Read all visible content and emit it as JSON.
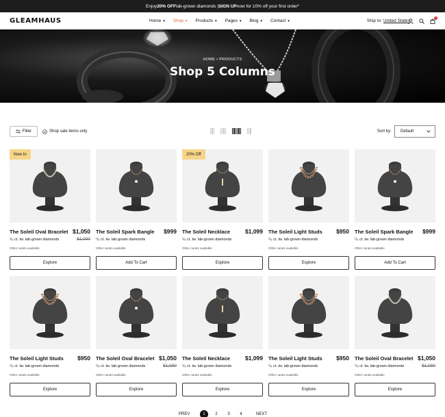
{
  "announcement": {
    "pre": "Enjoy ",
    "bold1": "20% OFF",
    "mid": " lab-grown diamonds | ",
    "bold2": "SIGN UP",
    "post": " now for 10% off your first order*"
  },
  "header": {
    "logo": "GLEAMHAUS",
    "nav": [
      "Home",
      "Shop",
      "Products",
      "Pages",
      "Blog",
      "Contact"
    ],
    "active_nav": "Shop",
    "ship_label": "Ship to:",
    "ship_value": "United States",
    "cart_count": "0",
    "accent": "#e06a3c"
  },
  "hero": {
    "breadcrumb_home": "HOME",
    "breadcrumb_sep": "•",
    "breadcrumb_current": "PRODUCTS",
    "title": "Shop 5 Columns"
  },
  "toolbar": {
    "filter_label": "Filter",
    "sale_label": "Shop sale items only",
    "sort_label": "Sort by:",
    "sort_value": "Default",
    "active_view": "5 columns"
  },
  "products": [
    {
      "name": "The Soleil Oval Bracelet",
      "price": "$1,050",
      "old_price": "$1,090",
      "desc": "¹/₄ ct. tw. lab-grown diamonds",
      "carats": "Other carats available",
      "button": "Explore",
      "tag": "New In",
      "necklace": "pearl"
    },
    {
      "name": "The Soleil Spark Bangle",
      "price": "$999",
      "old_price": "",
      "desc": "¹/₄ ct. tw. lab-grown diamonds",
      "carats": "Other carats available",
      "button": "Add To Cart",
      "tag": "",
      "necklace": "pendant"
    },
    {
      "name": "The Soleil Necklace",
      "price": "$1,099",
      "old_price": "",
      "desc": "¹/₄ ct. tw. lab-grown diamonds",
      "carats": "Other carats available",
      "button": "Explore",
      "tag": "20% Off",
      "necklace": "bar"
    },
    {
      "name": "The Soleil Light Studs",
      "price": "$950",
      "old_price": "",
      "desc": "¹/₄ ct. tw. lab-grown diamonds",
      "carats": "Other carats available",
      "button": "Explore",
      "tag": "",
      "necklace": "bead"
    },
    {
      "name": "The Soleil Spark Bangle",
      "price": "$999",
      "old_price": "",
      "desc": "¹/₄ ct. tw. lab-grown diamonds",
      "carats": "Other carats available",
      "button": "Add To Cart",
      "tag": "",
      "necklace": "pendant"
    },
    {
      "name": "The Soleil Light Studs",
      "price": "$950",
      "old_price": "",
      "desc": "¹/₄ ct. tw. lab-grown diamonds",
      "carats": "Other carats available",
      "button": "Explore",
      "tag": "",
      "necklace": "bead"
    },
    {
      "name": "The Soleil Oval Bracelet",
      "price": "$1,050",
      "old_price": "$1,090",
      "desc": "¹/₄ ct. tw. lab-grown diamonds",
      "carats": "Other carats available",
      "button": "Explore",
      "tag": "",
      "necklace": "pendant"
    },
    {
      "name": "The Soleil Necklace",
      "price": "$1,099",
      "old_price": "",
      "desc": "¹/₄ ct. tw. lab-grown diamonds",
      "carats": "Other carats available",
      "button": "Explore",
      "tag": "",
      "necklace": "bar"
    },
    {
      "name": "The Soleil Light Studs",
      "price": "$950",
      "old_price": "",
      "desc": "¹/₄ ct. tw. lab-grown diamonds",
      "carats": "Other carats available",
      "button": "Explore",
      "tag": "",
      "necklace": "bead"
    },
    {
      "name": "The Soleil Oval Bracelet",
      "price": "$1,050",
      "old_price": "$1,090",
      "desc": "¹/₄ ct. tw. lab-grown diamonds",
      "carats": "Other carats available",
      "button": "Explore",
      "tag": "",
      "necklace": "pearl"
    }
  ],
  "pagination": {
    "prev": "PREV",
    "pages": [
      "1",
      "2",
      "3",
      "4"
    ],
    "current": "1",
    "next": "NEXT"
  }
}
